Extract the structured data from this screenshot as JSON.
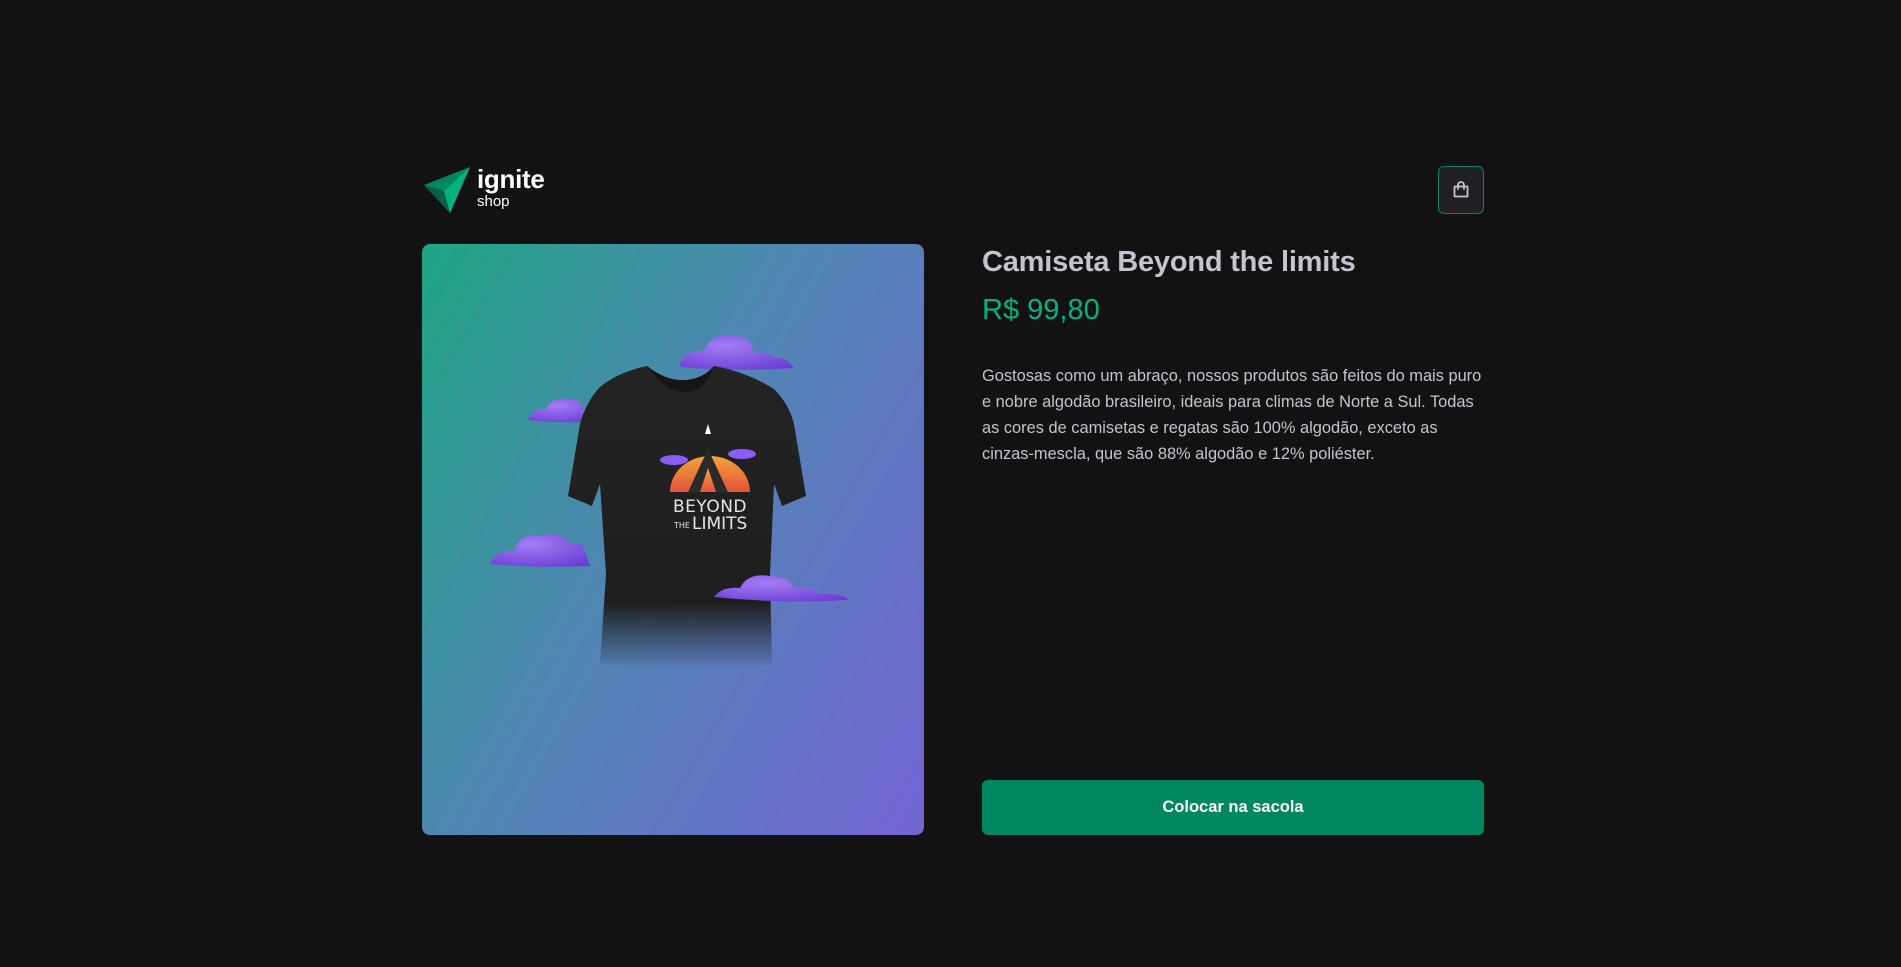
{
  "header": {
    "logo_title": "ignite",
    "logo_subtitle": "shop",
    "bag_icon": "shopping-bag-icon"
  },
  "product": {
    "title": "Camiseta Beyond the limits",
    "price": "R$ 99,80",
    "description": "Gostosas como um abraço, nossos produtos são feitos do mais puro e nobre algodão brasileiro, ideais para climas de Norte a Sul. Todas as cores de camisetas e regatas são 100% algodão, exceto as cinzas-mescla, que são 88% algodão e 12% poliéster.",
    "image_print_line1": "BEYOND",
    "image_print_line2_small": "THE",
    "image_print_line2": "LIMITS",
    "add_to_bag_label": "Colocar na sacola"
  },
  "colors": {
    "background": "#121214",
    "accent": "#00875f",
    "price": "#00b37e",
    "gradient_start": "#1ea483",
    "gradient_end": "#7465d4"
  }
}
